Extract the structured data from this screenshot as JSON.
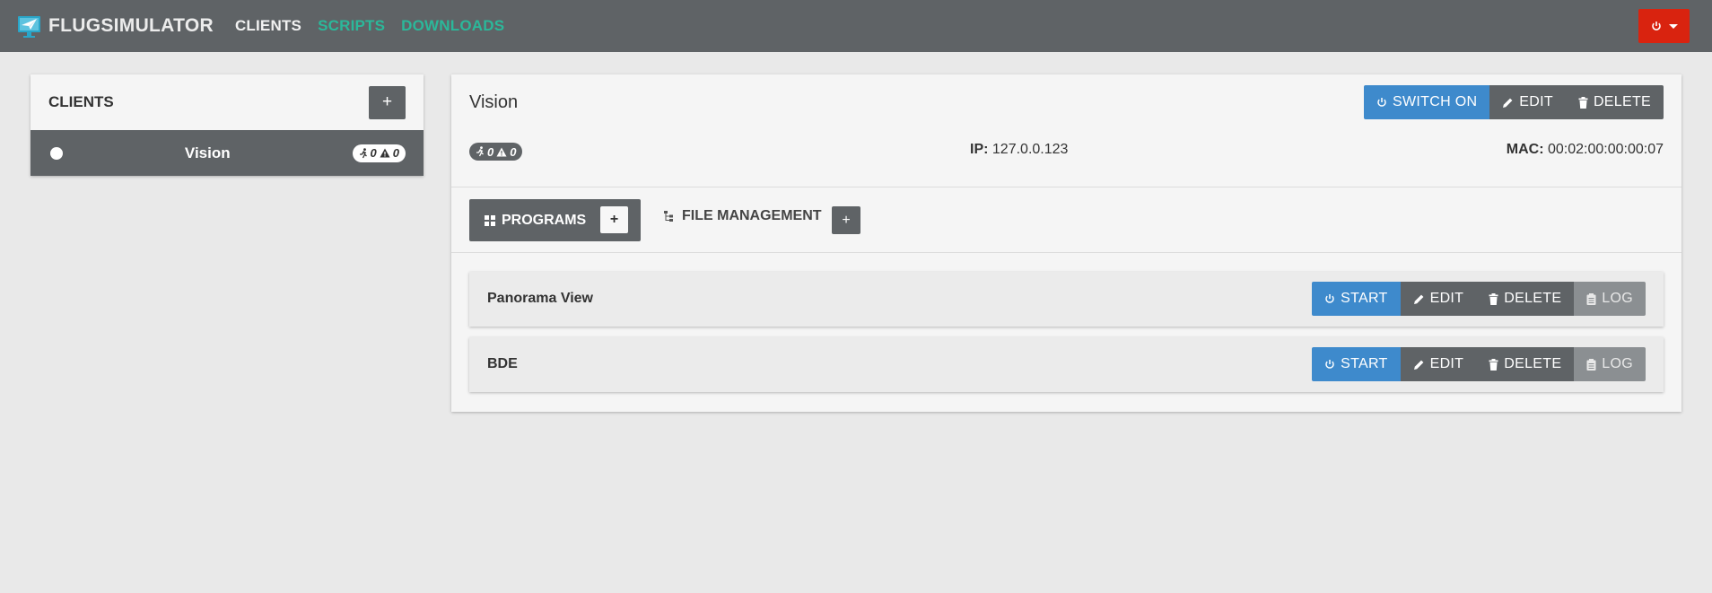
{
  "navbar": {
    "brand": "FLUGSIMULATOR",
    "links": [
      {
        "label": "CLIENTS",
        "active": true
      },
      {
        "label": "SCRIPTS",
        "active": false
      },
      {
        "label": "DOWNLOADS",
        "active": false
      }
    ],
    "power_menu_icon": "power-icon",
    "colors": {
      "navbar": "#5f6366",
      "active_link": "#f2f2f2",
      "link": "#2bb89a",
      "power_button": "#d9230f"
    }
  },
  "clients_panel": {
    "title": "CLIENTS",
    "add_label": "+",
    "clients": [
      {
        "name": "Vision",
        "runners": "0",
        "warnings": "0"
      }
    ]
  },
  "client_detail": {
    "name": "Vision",
    "actions": {
      "switch_on": "SWITCH ON",
      "edit": "EDIT",
      "delete": "DELETE"
    },
    "runners": "0",
    "warnings": "0",
    "ip_label": "IP:",
    "ip": "127.0.0.123",
    "mac_label": "MAC:",
    "mac": "00:02:00:00:00:07",
    "tabs": {
      "programs": "PROGRAMS",
      "programs_add": "+",
      "file_management": "FILE MANAGEMENT",
      "file_management_add": "+"
    },
    "programs": [
      {
        "name": "Panorama View",
        "start": "START",
        "edit": "EDIT",
        "delete": "DELETE",
        "log": "LOG"
      },
      {
        "name": "BDE",
        "start": "START",
        "edit": "EDIT",
        "delete": "DELETE",
        "log": "LOG"
      }
    ],
    "colors": {
      "primary": "#3e8acc",
      "secondary": "#5f6366",
      "log": "#8b8f92"
    }
  }
}
